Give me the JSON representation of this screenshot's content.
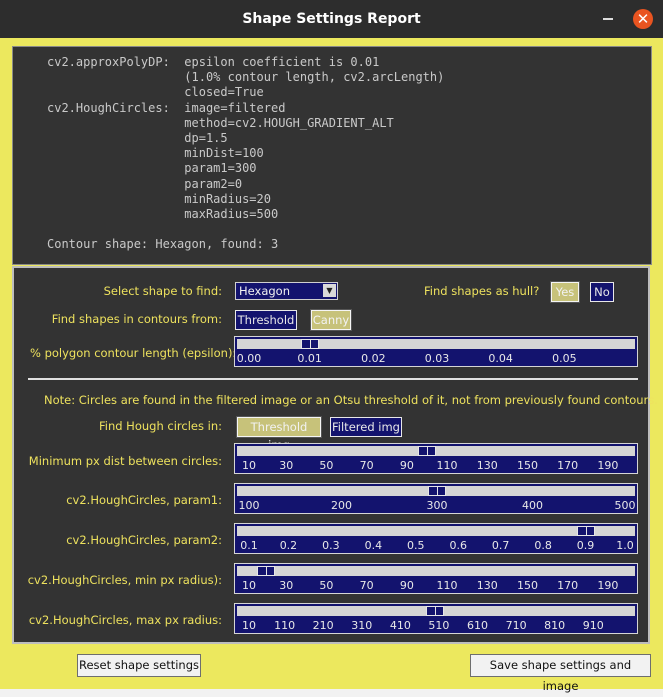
{
  "window": {
    "title": "Shape Settings Report"
  },
  "report": {
    "lines": [
      "cv2.approxPolyDP:  epsilon coefficient is 0.01",
      "                   (1.0% contour length, cv2.arcLength)",
      "                   closed=True",
      "cv2.HoughCircles:  image=filtered",
      "                   method=cv2.HOUGH_GRADIENT_ALT",
      "                   dp=1.5",
      "                   minDist=100",
      "                   param1=300",
      "                   param2=0",
      "                   minRadius=20",
      "                   maxRadius=500",
      "",
      "Contour shape: Hexagon, found: 3"
    ]
  },
  "controls": {
    "select_shape_label": "Select shape to find:",
    "select_shape_value": "Hexagon",
    "hull_label": "Find shapes as hull?",
    "hull_yes": "Yes",
    "hull_no": "No",
    "hull_selected": "Yes",
    "contours_from_label": "Find shapes in contours from:",
    "contours_threshold": "Threshold",
    "contours_canny": "Canny",
    "contours_selected": "Canny",
    "epsilon_label": "% polygon contour length (epsilon):",
    "note": "Note: Circles are found in the filtered image or an Otsu threshold of it, not from previously found contours.",
    "hough_in_label": "Find Hough circles in:",
    "hough_threshold_img": "Threshold img",
    "hough_filtered_img": "Filtered img",
    "hough_selected": "Threshold img",
    "min_dist_label": "Minimum px dist between circles:",
    "param1_label": "cv2.HoughCircles, param1:",
    "param2_label": "cv2.HoughCircles, param2:",
    "min_radius_label": "cv2.HoughCircles, min px radius):",
    "max_radius_label": "cv2.HoughCircles, max px radius:"
  },
  "sliders": {
    "epsilon": {
      "min": 0.0,
      "max": 0.06,
      "value": 0.01,
      "ticks": [
        "0.00",
        "0.01",
        "0.02",
        "0.03",
        "0.04",
        "0.05"
      ]
    },
    "min_dist": {
      "min": 10,
      "max": 200,
      "value": 100,
      "ticks": [
        "10",
        "30",
        "50",
        "70",
        "90",
        "110",
        "130",
        "150",
        "170",
        "190"
      ]
    },
    "param1": {
      "min": 100,
      "max": 500,
      "value": 300,
      "ticks": [
        "100",
        "200",
        "300",
        "400",
        "500"
      ]
    },
    "param2": {
      "min": 0.1,
      "max": 1.0,
      "value": 0.9,
      "ticks": [
        "0.1",
        "0.2",
        "0.3",
        "0.4",
        "0.5",
        "0.6",
        "0.7",
        "0.8",
        "0.9",
        "1.0"
      ]
    },
    "min_radius": {
      "min": 10,
      "max": 200,
      "value": 20,
      "ticks": [
        "10",
        "30",
        "50",
        "70",
        "90",
        "110",
        "130",
        "150",
        "170",
        "190"
      ]
    },
    "max_radius": {
      "min": 10,
      "max": 1000,
      "value": 500,
      "ticks": [
        "10",
        "110",
        "210",
        "310",
        "410",
        "510",
        "610",
        "710",
        "810",
        "910"
      ]
    }
  },
  "footer": {
    "reset_label": "Reset shape settings",
    "save_label": "Save shape settings and image"
  }
}
